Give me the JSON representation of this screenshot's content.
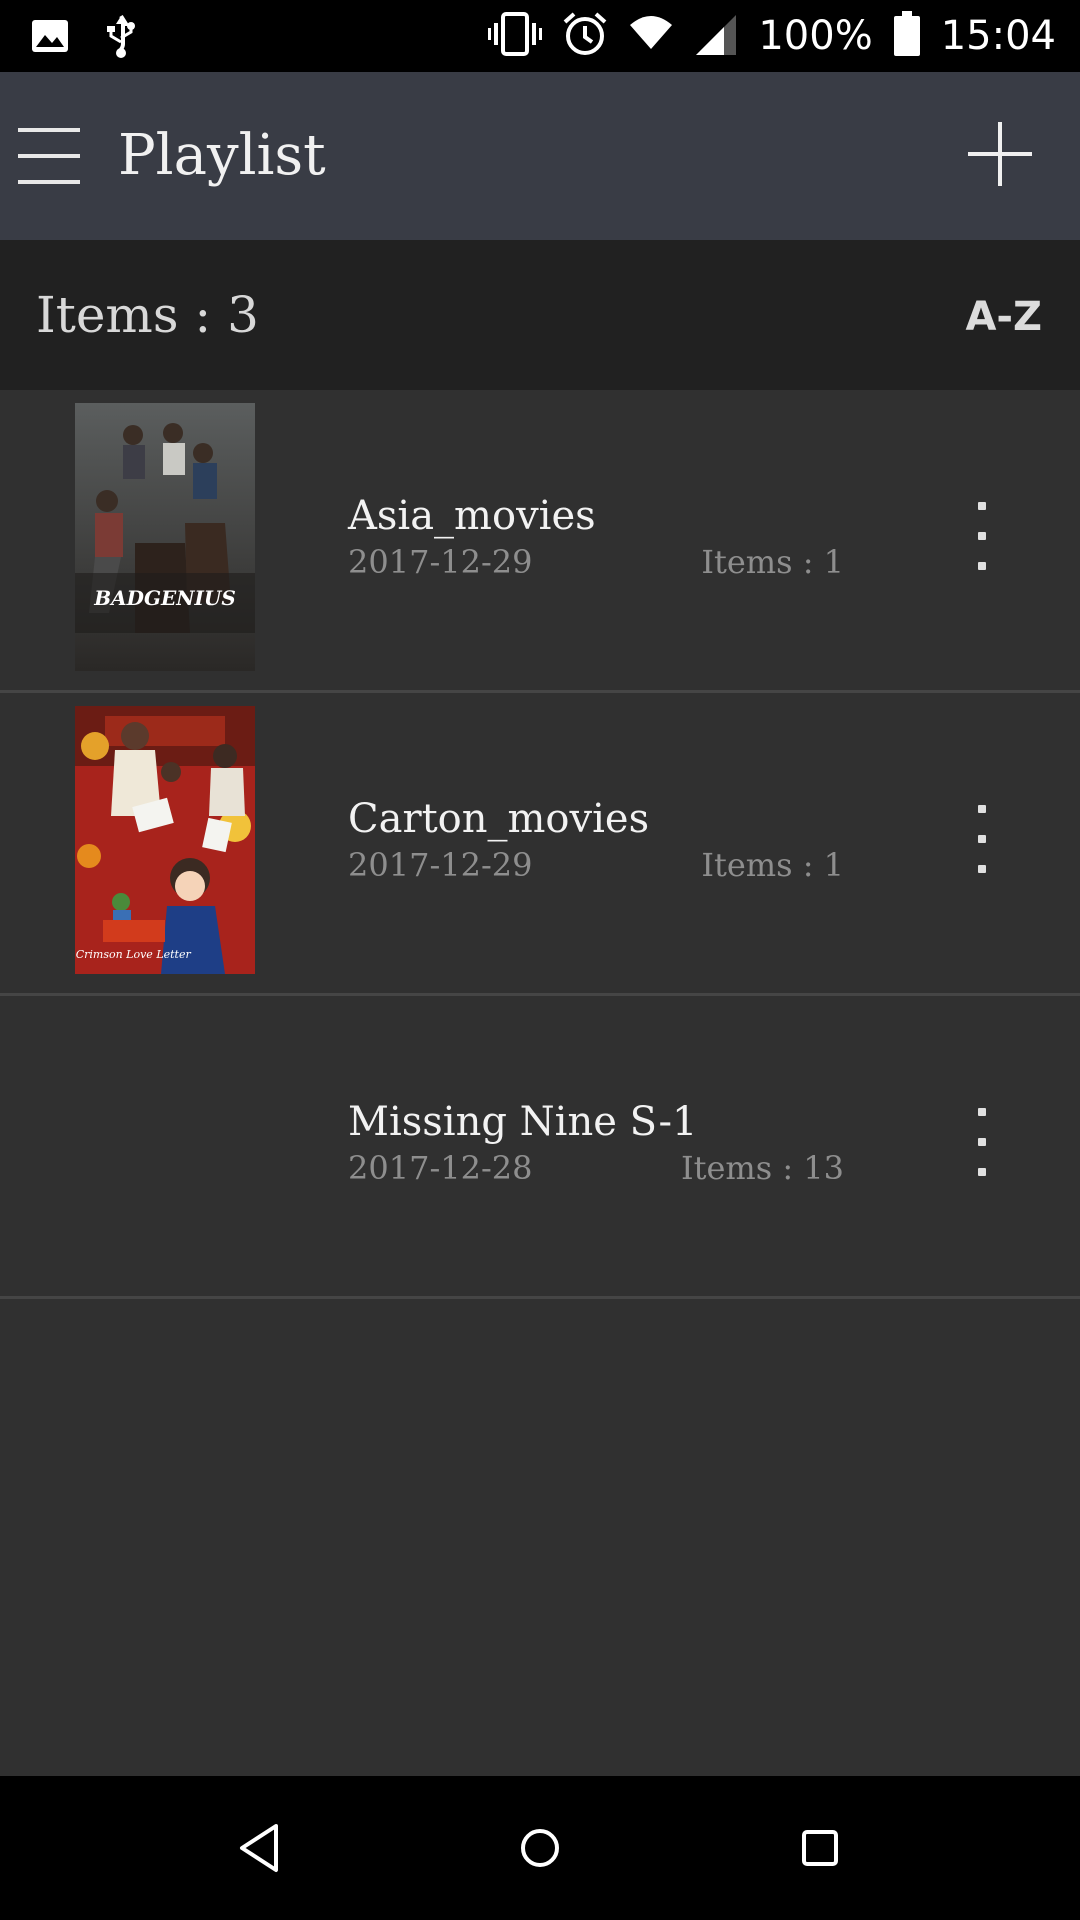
{
  "status_bar": {
    "battery": "100%",
    "time": "15:04",
    "icons": [
      "image-icon",
      "usb-icon",
      "vibrate-icon",
      "alarm-icon",
      "wifi-icon",
      "signal-icon",
      "battery-icon"
    ]
  },
  "app_bar": {
    "title": "Playlist",
    "menu_icon": "hamburger-menu-icon",
    "add_icon": "plus-icon"
  },
  "subheader": {
    "items_label": "Items : 3",
    "sort_label": "A-Z"
  },
  "playlists": [
    {
      "name": "Asia_movies",
      "date": "2017-12-29",
      "count": "Items : 1",
      "thumbnail": "BADGENIUS"
    },
    {
      "name": "Carton_movies",
      "date": "2017-12-29",
      "count": "Items : 1",
      "thumbnail": "The Crimson Love Letter"
    },
    {
      "name": "Missing Nine S-1",
      "date": "2017-12-28",
      "count": "Items : 13",
      "thumbnail": ""
    }
  ],
  "nav_bar": {
    "icons": [
      "back-icon",
      "home-icon",
      "recents-icon"
    ]
  },
  "colors": {
    "status_bar": "#000000",
    "app_bar": "#393c45",
    "subheader": "#212121",
    "list_background": "#303030",
    "nav_bar": "#000000"
  }
}
